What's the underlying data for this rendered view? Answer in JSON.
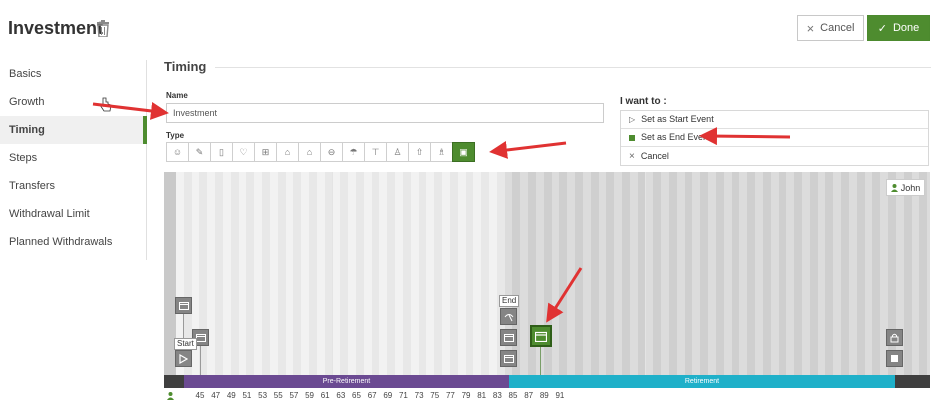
{
  "header": {
    "title": "Investment",
    "cancel_label": "Cancel",
    "done_label": "Done"
  },
  "sidebar": {
    "items": [
      {
        "label": "Basics"
      },
      {
        "label": "Growth"
      },
      {
        "label": "Timing",
        "active": true
      },
      {
        "label": "Steps"
      },
      {
        "label": "Transfers"
      },
      {
        "label": "Withdrawal Limit"
      },
      {
        "label": "Planned Withdrawals"
      }
    ]
  },
  "timing": {
    "section_title": "Timing",
    "name_label": "Name",
    "name_value": "Investment",
    "type_label": "Type",
    "type_icons": [
      "baby-icon",
      "wrench-icon",
      "book-icon",
      "wedding-icon",
      "gift-icon",
      "graduation-icon",
      "house-icon",
      "car-icon",
      "umbrella-icon",
      "paint-roller-icon",
      "people-icon",
      "arrow-up-icon",
      "couple-icon",
      "calendar-icon"
    ],
    "selected_type": "calendar-icon"
  },
  "i_want_to": {
    "title": "I want to :",
    "options": [
      {
        "label": "Set as Start Event",
        "icon": "play-outline-icon"
      },
      {
        "label": "Set as End Event",
        "icon": "green-square-icon"
      },
      {
        "label": "Cancel",
        "icon": "close-icon"
      }
    ]
  },
  "timeline": {
    "person": "John",
    "start_flag": "Start",
    "end_flag": "End",
    "phases": [
      {
        "label": "Pre-Retirement",
        "color": "#6b4a92"
      },
      {
        "label": "Retirement",
        "color": "#1fb0c9"
      }
    ],
    "ages": [
      "45",
      "47",
      "49",
      "51",
      "53",
      "55",
      "57",
      "59",
      "61",
      "63",
      "65",
      "67",
      "69",
      "71",
      "73",
      "75",
      "77",
      "79",
      "81",
      "83",
      "85",
      "87",
      "89",
      "91"
    ]
  },
  "colors": {
    "accent": "#4e8c2f",
    "arrow": "#e03232"
  }
}
